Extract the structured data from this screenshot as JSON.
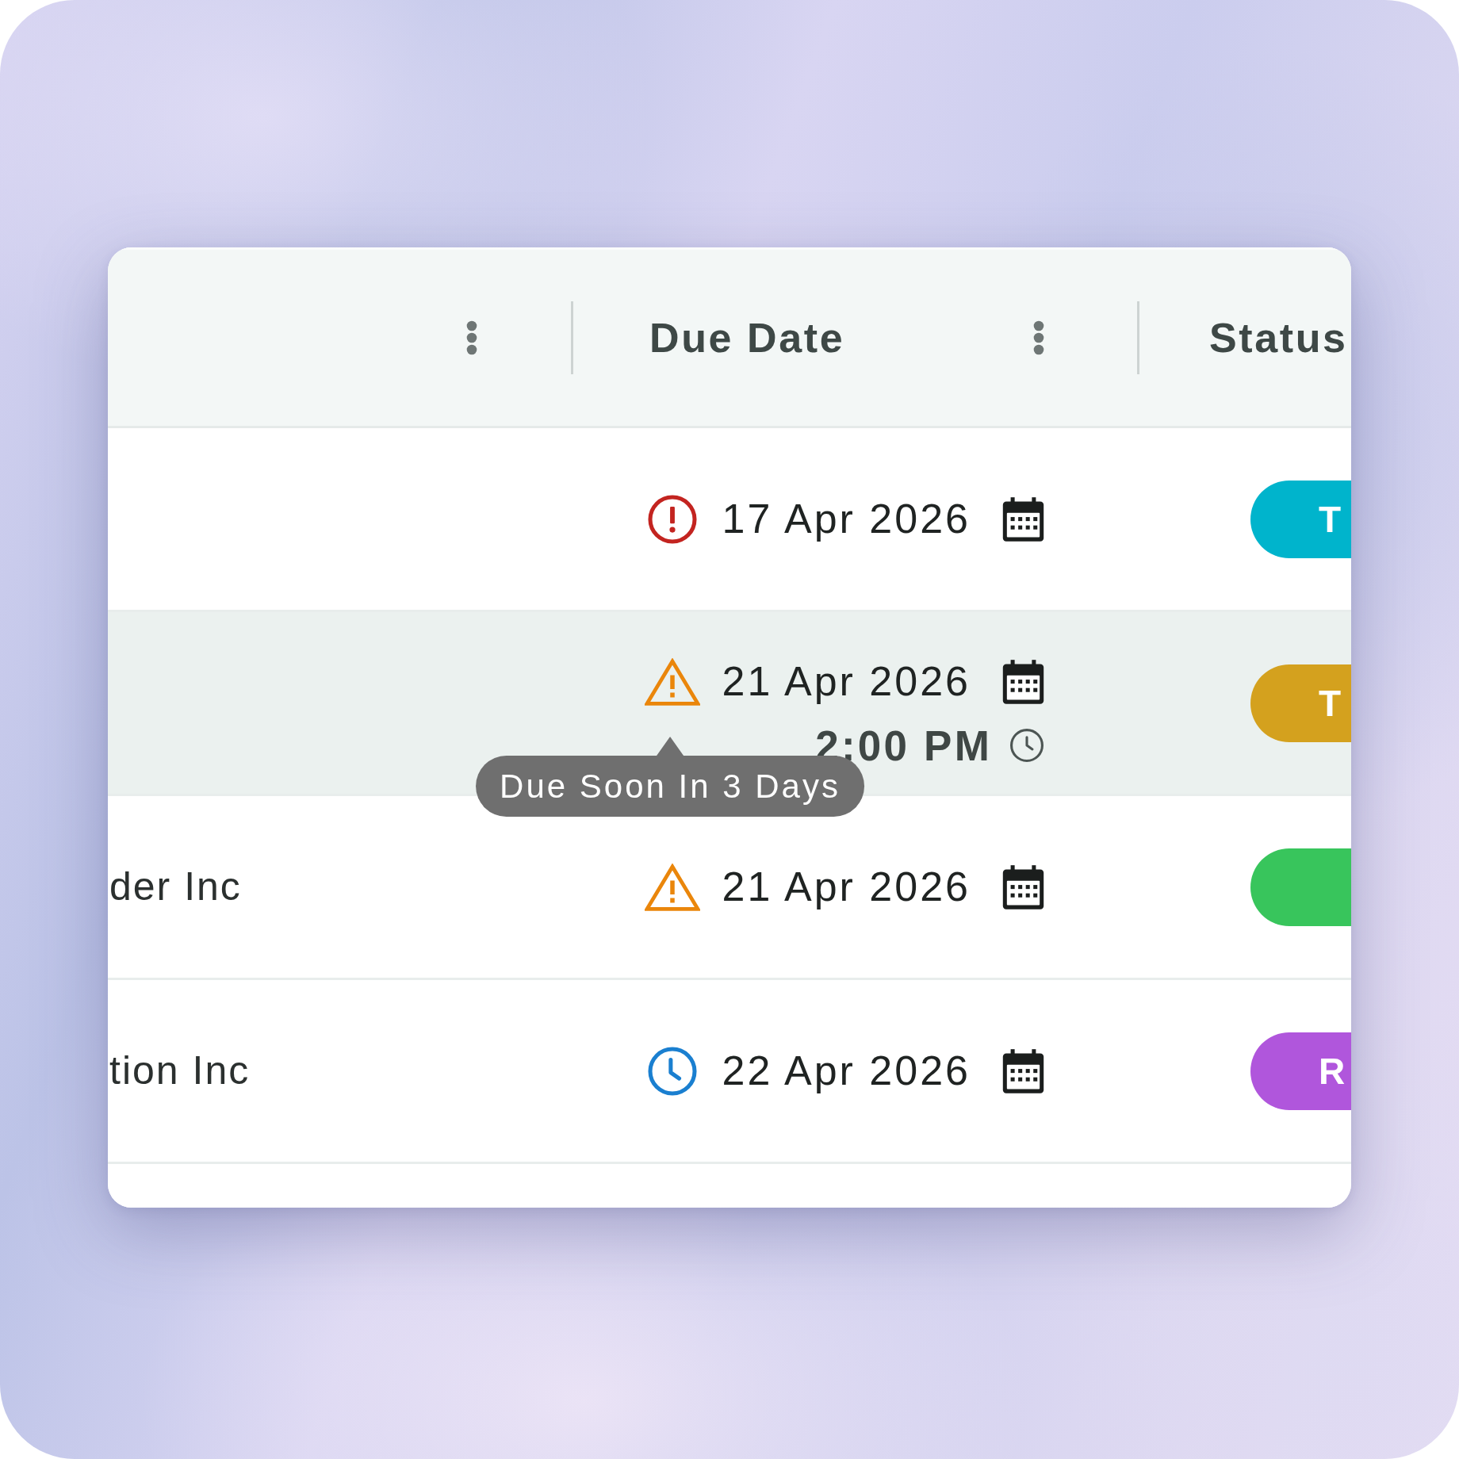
{
  "table": {
    "columns": [
      {
        "has_menu": true
      },
      {
        "label": "Due Date",
        "has_menu": true
      },
      {
        "label": "Status",
        "has_menu": false
      }
    ],
    "rows": [
      {
        "hovered": false,
        "due": {
          "kind": "overdue",
          "date": "17 Apr 2026"
        },
        "status": {
          "label": "T",
          "color": "#00b4cc"
        }
      },
      {
        "hovered": true,
        "due": {
          "kind": "due_soon",
          "date": "21 Apr 2026",
          "time": "2:00 PM",
          "tooltip": "Due Soon In 3 Days"
        },
        "status": {
          "label": "T",
          "color": "#d4a11e"
        }
      },
      {
        "hovered": false,
        "column_1": "der Inc",
        "due": {
          "kind": "due_soon",
          "date": "21 Apr 2026"
        },
        "status": {
          "color": "#38c55c"
        }
      },
      {
        "hovered": false,
        "column_1": "tion Inc",
        "due": {
          "kind": "upcoming",
          "date": "22 Apr 2026"
        },
        "status": {
          "label": "R",
          "color": "#b056dc"
        }
      }
    ]
  }
}
